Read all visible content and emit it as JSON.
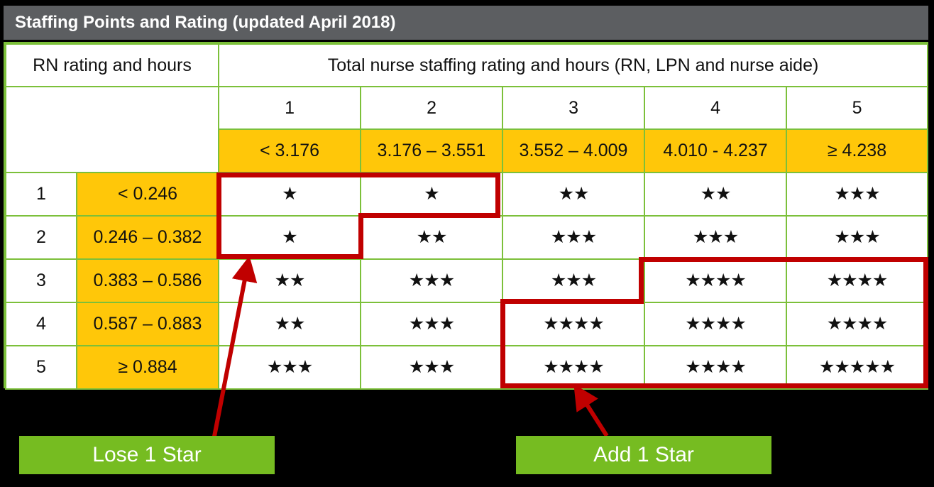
{
  "title": "Staffing Points and Rating (updated April 2018)",
  "table": {
    "row_header_label": "RN rating and hours",
    "col_header_label": "Total nurse staffing rating and hours (RN, LPN and nurse aide)",
    "column_ratings": [
      "1",
      "2",
      "3",
      "4",
      "5"
    ],
    "column_hours": [
      "< 3.176",
      "3.176 – 3.551",
      "3.552 – 4.009",
      "4.010 - 4.237",
      "≥ 4.238"
    ],
    "row_ratings": [
      "1",
      "2",
      "3",
      "4",
      "5"
    ],
    "row_hours": [
      "< 0.246",
      "0.246 – 0.382",
      "0.383 – 0.586",
      "0.587 – 0.883",
      "≥ 0.884"
    ],
    "star_counts": [
      [
        1,
        1,
        2,
        2,
        3
      ],
      [
        1,
        2,
        3,
        3,
        3
      ],
      [
        2,
        3,
        3,
        4,
        4
      ],
      [
        2,
        3,
        4,
        4,
        4
      ],
      [
        3,
        3,
        4,
        4,
        5
      ]
    ],
    "star_glyphs": [
      [
        "★",
        "★",
        "★★",
        "★★",
        "★★★"
      ],
      [
        "★",
        "★★",
        "★★★",
        "★★★",
        "★★★"
      ],
      [
        "★★",
        "★★★",
        "★★★",
        "★★★★",
        "★★★★"
      ],
      [
        "★★",
        "★★★",
        "★★★★",
        "★★★★",
        "★★★★"
      ],
      [
        "★★★",
        "★★★",
        "★★★★",
        "★★★★",
        "★★★★★"
      ]
    ]
  },
  "callouts": {
    "lose": "Lose 1 Star",
    "add": "Add 1 Star"
  },
  "colors": {
    "title_bar": "#5c5e61",
    "grid_line": "#7cc03a",
    "cell_yellow": "#ffc709",
    "highlight_red": "#c00000",
    "callout_green": "#76bc21",
    "background": "#000000"
  }
}
